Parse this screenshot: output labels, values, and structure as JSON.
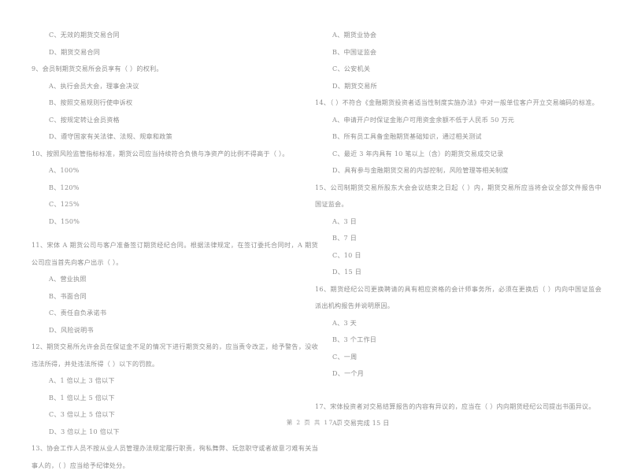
{
  "document": {
    "footer": "第 2 页 共 17 页",
    "page_number": 2,
    "total_pages": 17,
    "background_color": "#ffffff",
    "text_color": "#5f5f5f"
  },
  "left_column": {
    "trailing_options_of_previous_question": [
      "C、无效的期货交易合同",
      "D、期货交易合同"
    ],
    "questions": [
      {
        "number": "9",
        "stem": "9、会员制期货交易所会员享有（    ）的权利。",
        "options": [
          "A、执行会员大会，理事会决议",
          "B、按照交易规则行使申诉权",
          "C、按规定转让会员资格",
          "D、遵守国家有关法律、法规、规章和政策"
        ]
      },
      {
        "number": "10",
        "stem": "10、按照风险监管指标标准，期货公司应当持续符合负债与净资产的比例不得高于（    ）。",
        "options": [
          "A、100%",
          "B、120%",
          "C、125%",
          "D、150%"
        ]
      },
      {
        "number": "11",
        "stem": "11、宋体 A 期货公司与客户准备签订期货经纪合同。根据法律规定，在签订委托合同时，A 期货公司应当首先向客户出示（    ）。",
        "options": [
          "A、营业执照",
          "B、书面合同",
          "C、责任自负承诺书",
          "D、风险说明书"
        ]
      },
      {
        "number": "12",
        "stem": "12、期货交易所允许会员在保证金不足的情况下进行期货交易的，应当责令改正，给予警告，没收违法所得，并处违法所得（    ）以下的罚款。",
        "options": [
          "A、1 倍以上 3 倍以下",
          "B、1 倍以上 5 倍以下",
          "C、3 倍以上 5 倍以下",
          "D、3 倍以上 10 倍以下"
        ]
      },
      {
        "number": "13",
        "stem": "13、协会工作人员不按从业人员管理办法规定履行职责，徇私舞弊、玩忽职守或者故意刁难有关当事人的，（    ）应当给予纪律处分。",
        "options": []
      }
    ]
  },
  "right_column": {
    "trailing_options_of_previous_question": [
      "A、期货业协会",
      "B、中国证监会",
      "C、公安机关",
      "D、期货交易所"
    ],
    "questions": [
      {
        "number": "14",
        "stem": "14、（    ）不符合《金融期货投资者适当性制度实施办法》中对一般单位客户开立交易编码的标准。",
        "options": [
          "A、申请开户时保证金账户可用资金余额不低于人民币 50 万元",
          "B、所有员工具备金融期货基础知识，通过相关测试",
          "C、最近 3 年内具有 10 笔以上（含）的期货交易成交记录",
          "D、具有参与金融期货交易的内部控制，风险管理等相关制度"
        ]
      },
      {
        "number": "15",
        "stem": "15、公司制期货交易所股东大会会议结束之日起（    ）内，期货交易所应当将会议全部文件报告中国证监会。",
        "options": [
          "A、3 日",
          "B、7 日",
          "C、10 日",
          "D、15 日"
        ]
      },
      {
        "number": "16",
        "stem": "16、期货经纪公司更换聘请的具有相应资格的会计师事务所，必须在更换后（    ）内向中国证监会派出机构报告并说明原因。",
        "options": [
          "A、3 天",
          "B、3 个工作日",
          "C、一周",
          "D、一个月"
        ]
      },
      {
        "number": "17",
        "stem": "17、宋体投资者对交易结算报告的内容有异议的，应当在（    ）内向期货经纪公司提出书面异议。",
        "options": [
          "A、交易完成 15 日"
        ]
      }
    ]
  }
}
